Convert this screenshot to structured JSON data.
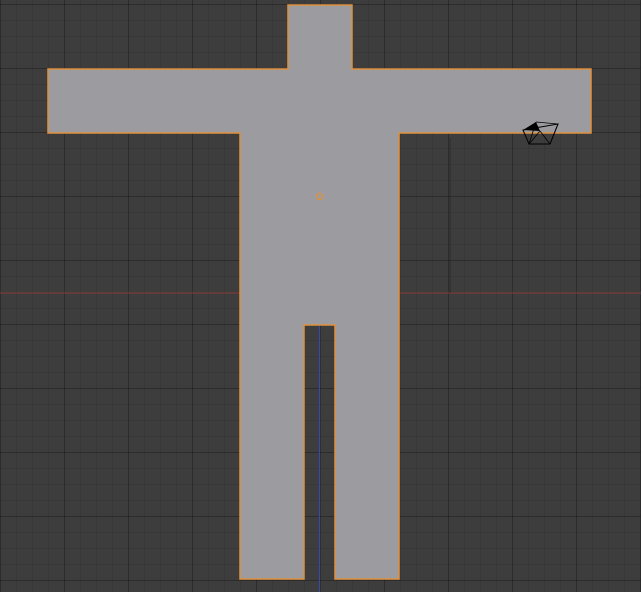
{
  "viewport": {
    "background": "#3d3d3d",
    "x_axis_color": "#8a3b3b",
    "y_axis_color": "#3b4a9a"
  },
  "selected_object": {
    "fill": "#9b9ba0",
    "outline": "#e0913e",
    "origin_color": "#e0913e"
  },
  "camera": {
    "icon": "camera-icon"
  }
}
